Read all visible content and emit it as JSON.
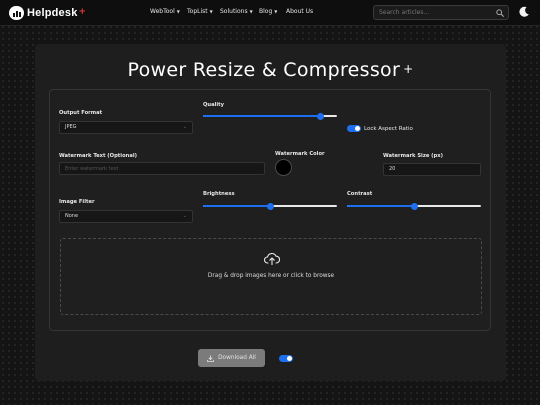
{
  "nav": {
    "brand": "Helpdesk",
    "brand_plus": "+",
    "items": [
      {
        "label": "WebTool",
        "has_caret": true
      },
      {
        "label": "TopList",
        "has_caret": true
      },
      {
        "label": "Solutions",
        "has_caret": true
      },
      {
        "label": "Blog",
        "has_caret": true
      },
      {
        "label": "About Us",
        "has_caret": false
      }
    ],
    "search_placeholder": "Search articles...",
    "theme_icon": "moon-icon"
  },
  "page": {
    "title": "Power Resize & Compressor",
    "title_plus": "+"
  },
  "form": {
    "output_format": {
      "label": "Output Format",
      "value": "JPEG"
    },
    "quality": {
      "label": "Quality",
      "level": 0.88
    },
    "lock_aspect": {
      "label": "Lock Aspect Ratio",
      "on": true
    },
    "watermark_text": {
      "label": "Watermark Text (Optional)",
      "placeholder": "Enter watermark text"
    },
    "watermark_color": {
      "label": "Watermark Color",
      "value": "#000000"
    },
    "watermark_size": {
      "label": "Watermark Size (px)",
      "value": "20"
    },
    "image_filter": {
      "label": "Image Filter",
      "value": "None"
    },
    "brightness": {
      "label": "Brightness",
      "level": 0.5
    },
    "contrast": {
      "label": "Contrast",
      "level": 0.5
    },
    "dropzone": {
      "text": "Drag & drop images here or click to browse",
      "icon": "cloud-upload-icon"
    }
  },
  "actions": {
    "download_all": "Download All",
    "toggle_on": true
  },
  "colors": {
    "accent": "#1e6ff0",
    "button_disabled": "#7b7b7b",
    "background": "#141414",
    "card": "#1e1e1e"
  }
}
